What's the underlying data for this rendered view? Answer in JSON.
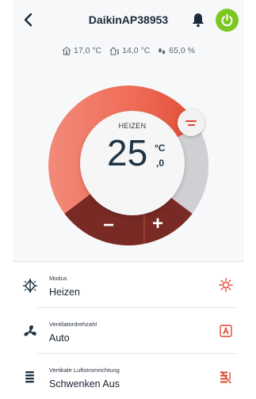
{
  "header": {
    "title": "DaikinAP38953"
  },
  "stats": {
    "indoor_temp": "17,0 °C",
    "outdoor_temp": "14,0 °C",
    "humidity": "65,0 %"
  },
  "thermostat": {
    "mode_label": "HEIZEN",
    "temp_integer": "25",
    "temp_unit": "°C",
    "temp_decimal": ",0",
    "minus_label": "−",
    "plus_label": "+"
  },
  "settings": {
    "mode": {
      "label": "Modus",
      "value": "Heizen"
    },
    "fan_speed": {
      "label": "Ventilatordrehzahl",
      "value": "Auto"
    },
    "vertical_airflow": {
      "label": "Vertikale Luftstromrichtung",
      "value": "Schwenken Aus"
    }
  },
  "colors": {
    "accent": "#e0472f",
    "power": "#7cc621",
    "text": "#1c2a3a"
  }
}
